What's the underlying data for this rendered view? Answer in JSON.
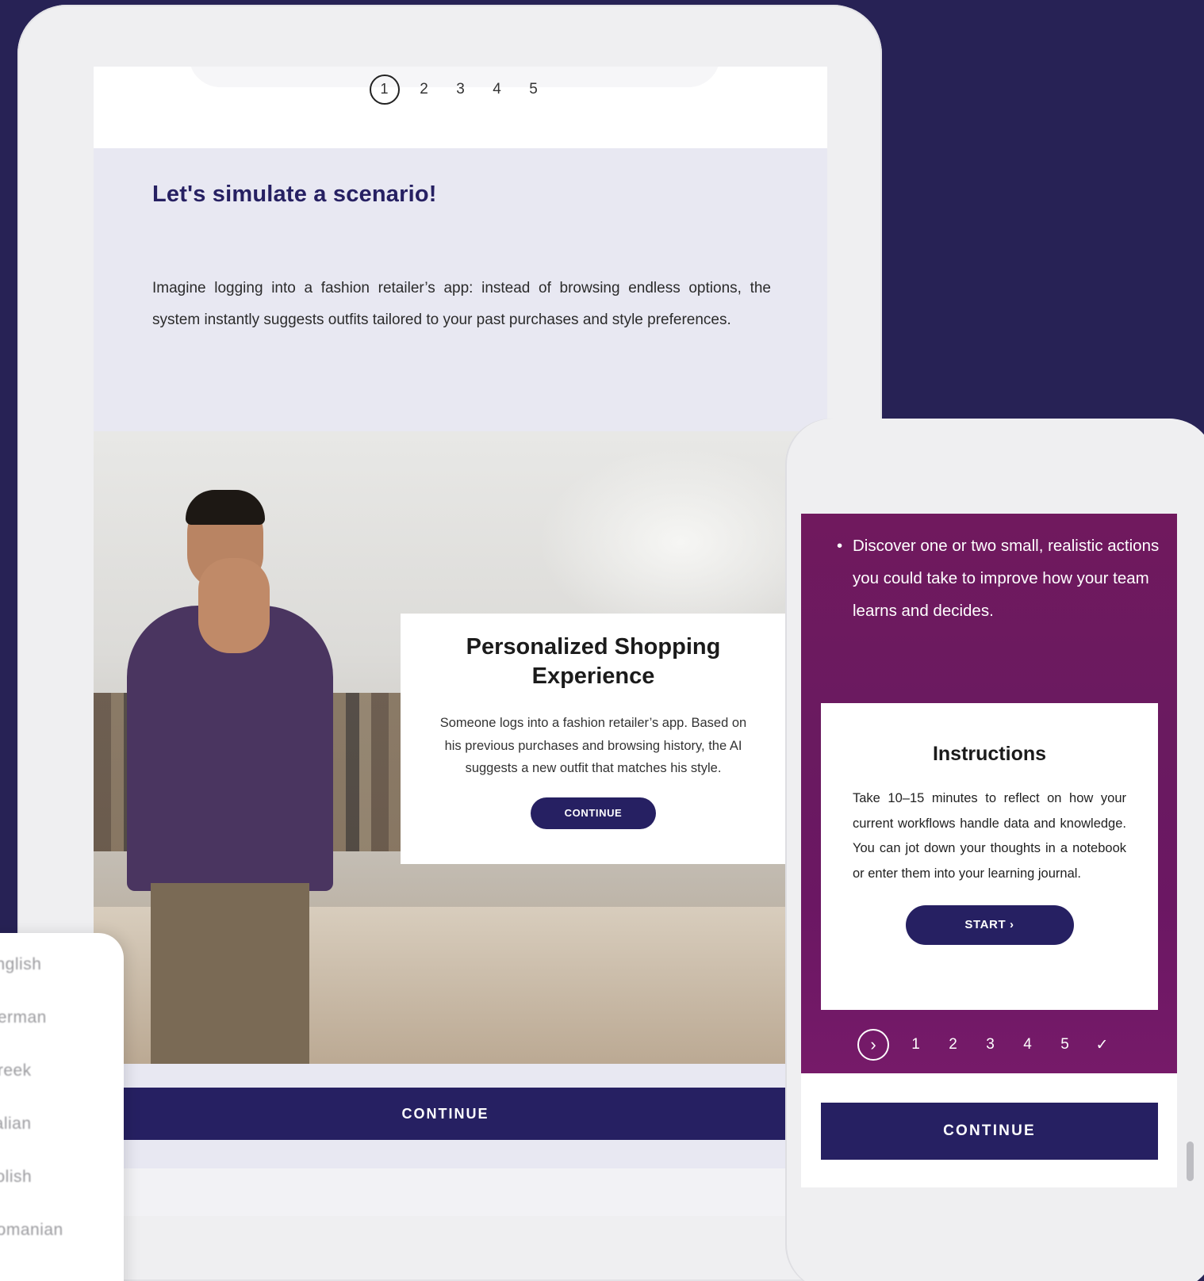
{
  "tablet": {
    "steps": [
      "1",
      "2",
      "3",
      "4",
      "5"
    ],
    "title": "Let's simulate a scenario!",
    "intro_text": "Imagine logging into a fashion retailer’s app: instead of browsing endless options, the system instantly suggests outfits tailored to your past purchases and style preferences.",
    "modal": {
      "title": "Personalized Shopping Experience",
      "body": "Someone logs into a fashion retailer’s app. Based on his previous purchases and browsing history, the AI suggests a new outfit that matches his style.",
      "button": "CONTINUE"
    },
    "continue_label": "CONTINUE"
  },
  "languages": [
    "English",
    "German",
    "Greek",
    "Italian",
    "Polish",
    "Romanian"
  ],
  "phone": {
    "bullet": "Discover one or two small, realistic actions you could take to improve how your team learns and decides.",
    "instructions": {
      "title": "Instructions",
      "body": "Take 10–15 minutes to reflect on how your current workflows handle data and knowledge. You can jot down your thoughts in a notebook or enter them into your learning journal.",
      "button": "START ›"
    },
    "steps": [
      "1",
      "2",
      "3",
      "4",
      "5",
      "✓"
    ],
    "continue_label": "CONTINUE"
  },
  "colors": {
    "background": "#272255",
    "primary": "#262062",
    "purple": "#6e1a62"
  }
}
